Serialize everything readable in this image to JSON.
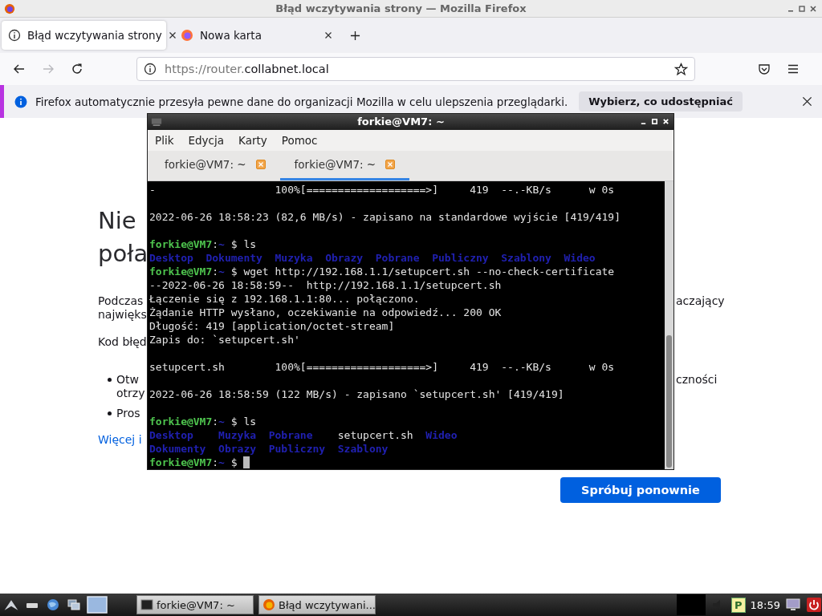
{
  "window": {
    "title": "Błąd wczytywania strony — Mozilla Firefox"
  },
  "tabs": [
    {
      "label": "Błąd wczytywania strony",
      "selected": true
    },
    {
      "label": "Nowa karta",
      "selected": false
    }
  ],
  "nav": {
    "forward_disabled": true,
    "url_prefix": "https://router.",
    "url_host": "collabnet.local"
  },
  "notification": {
    "text": "Firefox automatycznie przesyła pewne dane do organizacji Mozilla w celu ulepszenia przeglądarki.",
    "button": "Wybierz, co udostępniać"
  },
  "error_page": {
    "heading_lines": [
      "Nie",
      "poła"
    ],
    "blocks": [
      {
        "kind": "paragraph",
        "left": [
          "Podczas",
          "najwięks"
        ],
        "right": [
          "aczający"
        ]
      },
      {
        "kind": "paragraph",
        "left": [
          "Kod błęd"
        ]
      },
      {
        "kind": "bullet",
        "left": [
          "Otw",
          "otrzy"
        ],
        "right": [
          "czności"
        ]
      },
      {
        "kind": "bullet",
        "left": [
          "Pros"
        ]
      },
      {
        "kind": "link",
        "left": [
          "Więcej i"
        ]
      }
    ],
    "button": "Spróbuj ponownie"
  },
  "terminal": {
    "title": "forkie@VM7: ~",
    "menu": [
      "Plik",
      "Edycja",
      "Karty",
      "Pomoc"
    ],
    "tabs": [
      {
        "label": "forkie@VM7: ~",
        "selected": false
      },
      {
        "label": "forkie@VM7: ~",
        "selected": true
      }
    ],
    "lines": [
      {
        "kind": "text",
        "text": "-                   100%[===================>]     419  --.-KB/s      w 0s"
      },
      {
        "kind": "blank"
      },
      {
        "kind": "text",
        "text": "2022-06-26 18:58:23 (82,6 MB/s) - zapisano na standardowe wyjście [419/419]"
      },
      {
        "kind": "blank"
      },
      {
        "kind": "prompt",
        "user": "forkie@VM7",
        "separator": ":",
        "path": "~",
        "symbol": "$",
        "command": "ls"
      },
      {
        "kind": "listing",
        "rows": [
          [
            {
              "name": "Desktop",
              "dir": true
            },
            {
              "name": "Dokumenty",
              "dir": true
            },
            {
              "name": "Muzyka",
              "dir": true
            },
            {
              "name": "Obrazy",
              "dir": true
            },
            {
              "name": "Pobrane",
              "dir": true
            },
            {
              "name": "Publiczny",
              "dir": true
            },
            {
              "name": "Szablony",
              "dir": true
            },
            {
              "name": "Wideo",
              "dir": true
            }
          ]
        ]
      },
      {
        "kind": "prompt",
        "user": "forkie@VM7",
        "separator": ":",
        "path": "~",
        "symbol": "$",
        "command": "wget http://192.168.1.1/setupcert.sh --no-check-certificate"
      },
      {
        "kind": "text",
        "text": "--2022-06-26 18:58:59--  http://192.168.1.1/setupcert.sh"
      },
      {
        "kind": "text",
        "text": "Łączenie się z 192.168.1.1:80... połączono."
      },
      {
        "kind": "text",
        "text": "Żądanie HTTP wysłano, oczekiwanie na odpowiedź... 200 OK"
      },
      {
        "kind": "text",
        "text": "Długość: 419 [application/octet-stream]"
      },
      {
        "kind": "text",
        "text": "Zapis do: `setupcert.sh'"
      },
      {
        "kind": "blank"
      },
      {
        "kind": "text",
        "text": "setupcert.sh        100%[===================>]     419  --.-KB/s      w 0s"
      },
      {
        "kind": "blank"
      },
      {
        "kind": "text",
        "text": "2022-06-26 18:58:59 (122 MB/s) - zapisano `setupcert.sh' [419/419]"
      },
      {
        "kind": "blank"
      },
      {
        "kind": "prompt",
        "user": "forkie@VM7",
        "separator": ":",
        "path": "~",
        "symbol": "$",
        "command": "ls"
      },
      {
        "kind": "listing",
        "rows": [
          [
            {
              "name": "Desktop",
              "dir": true
            },
            {
              "name": "Muzyka",
              "dir": true
            },
            {
              "name": "Pobrane",
              "dir": true
            },
            {
              "name": "setupcert.sh",
              "dir": false
            },
            {
              "name": "Wideo",
              "dir": true
            }
          ],
          [
            {
              "name": "Dokumenty",
              "dir": true
            },
            {
              "name": "Obrazy",
              "dir": true
            },
            {
              "name": "Publiczny",
              "dir": true
            },
            {
              "name": "Szablony",
              "dir": true
            }
          ]
        ]
      },
      {
        "kind": "prompt",
        "user": "forkie@VM7",
        "separator": ":",
        "path": "~",
        "symbol": "$",
        "cursor": true
      }
    ]
  },
  "taskbar": {
    "tasks": [
      {
        "label": "forkie@VM7: ~"
      },
      {
        "label": "Błąd wczytywani..."
      }
    ],
    "tray_badge": "P",
    "clock": "18:59"
  }
}
